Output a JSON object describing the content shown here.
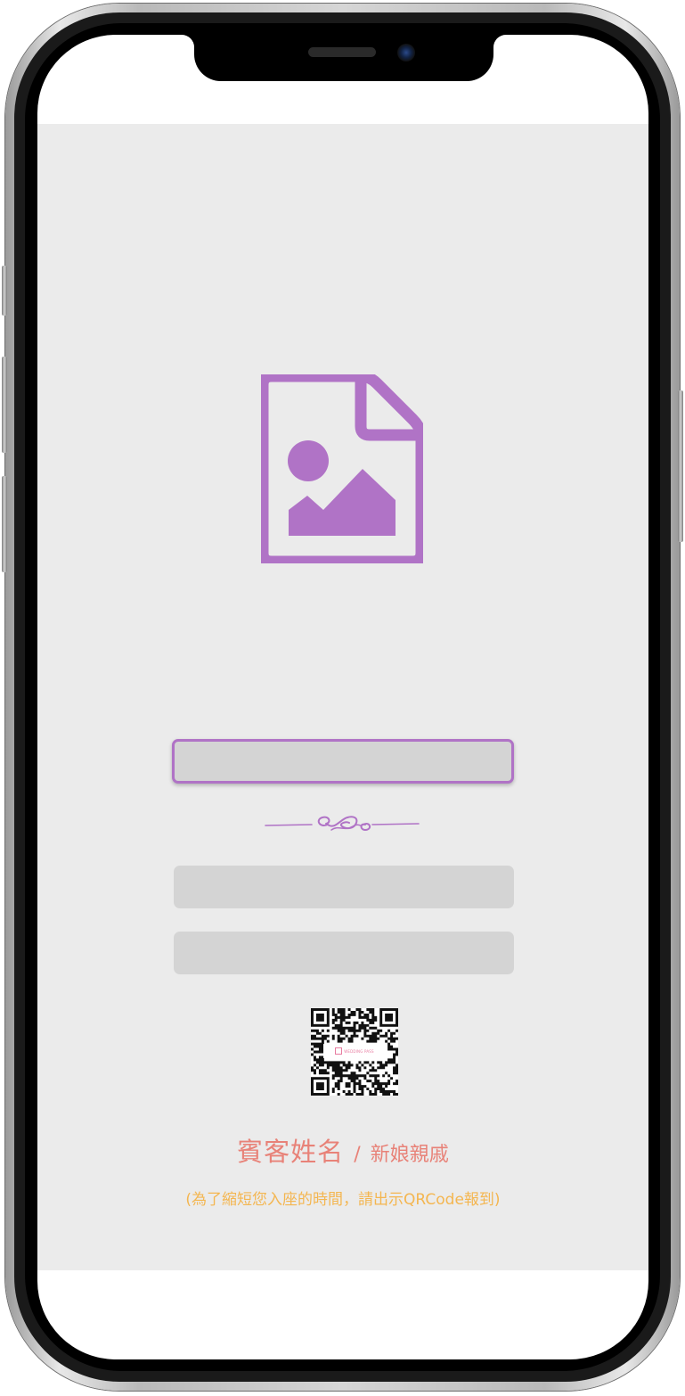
{
  "invitation": {
    "guest_name": "賓客姓名",
    "separator": "/",
    "guest_relation": "新娘親戚",
    "hint": "(為了縮短您入座的時間，請出示QRCode報到)",
    "qr_brand": "WEDDING PASS"
  },
  "icons": {
    "photo_placeholder": "image-file-icon",
    "divider": "flourish-divider-icon",
    "qr": "qr-code-icon"
  },
  "colors": {
    "accent_purple": "#b073c6",
    "name_pink": "#e88278",
    "hint_orange": "#f4b650",
    "content_bg": "#ebebeb",
    "field_gray": "#d4d4d4"
  }
}
